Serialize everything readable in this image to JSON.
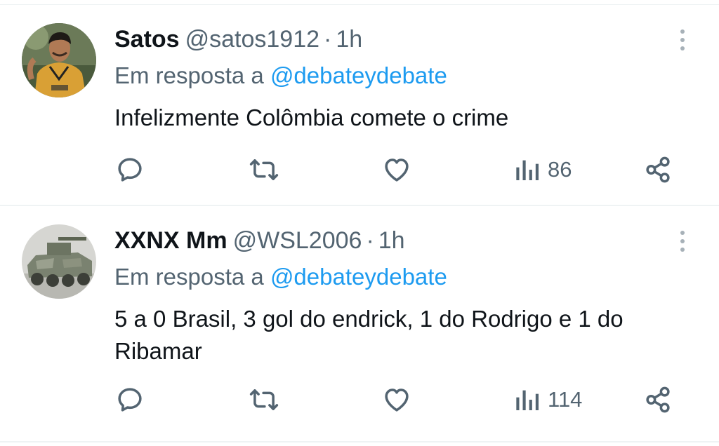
{
  "tweets": [
    {
      "author_name": "Satos",
      "handle": "@satos1912",
      "separator": "·",
      "time": "1h",
      "reply_prefix": "Em resposta a",
      "reply_handle": "@debateydebate",
      "text": "Infelizmente Colômbia comete o crime",
      "views": "86",
      "avatar_icon": "soccer-player-photo"
    },
    {
      "author_name": "XXNX Mm",
      "handle": "@WSL2006",
      "separator": "·",
      "time": "1h",
      "reply_prefix": "Em resposta a",
      "reply_handle": "@debateydebate",
      "text": "5 a 0 Brasil, 3 gol do endrick, 1 do Rodrigo e 1 do Ribamar",
      "views": "114",
      "avatar_icon": "armored-vehicle-photo"
    }
  ],
  "colors": {
    "text_primary": "#0f1419",
    "text_secondary": "#536471",
    "link": "#1d9bf0",
    "divider": "#eff3f4"
  },
  "icons": [
    "reply-icon",
    "retweet-icon",
    "like-icon",
    "views-icon",
    "share-icon",
    "more-icon"
  ]
}
